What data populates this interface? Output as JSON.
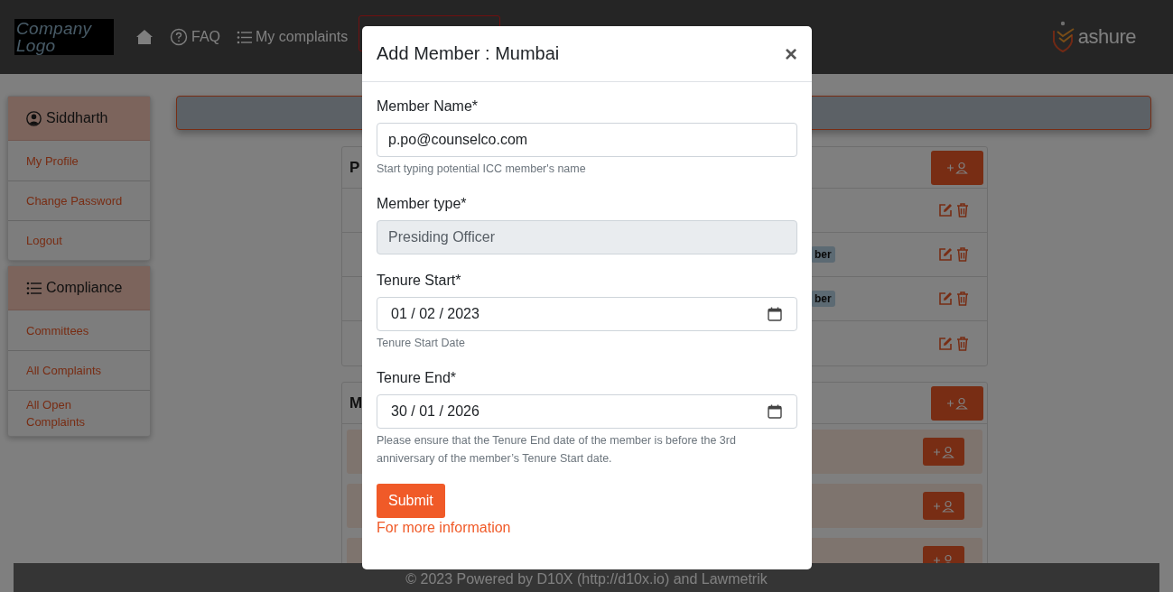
{
  "header": {
    "logo_text": "Company Logo",
    "nav": [
      {
        "kind": "home"
      },
      {
        "kind": "faq",
        "label": "FAQ"
      },
      {
        "kind": "list",
        "label": "My complaints"
      }
    ],
    "brand": "ashure"
  },
  "sidebar": [
    {
      "kind": "user",
      "title": "Siddharth",
      "items": [
        "My Profile",
        "Change Password",
        "Logout"
      ]
    },
    {
      "kind": "list",
      "title": "Compliance",
      "items": [
        "Committees",
        "All Complaints",
        "All Open Complaints"
      ]
    }
  ],
  "cards": [
    {
      "heading": "P",
      "rows": [
        {
          "kind": "member"
        },
        {
          "kind": "member",
          "badge": "ber"
        },
        {
          "kind": "member",
          "badge": "ber"
        },
        {
          "kind": "member"
        }
      ]
    },
    {
      "heading": "M",
      "rows": [
        {
          "kind": "group"
        },
        {
          "kind": "group"
        },
        {
          "kind": "group"
        }
      ]
    }
  ],
  "footer": "© 2023 Powered by D10X (http://d10x.io) and Lawmetrik",
  "modal": {
    "title": "Add Member : Mumbai",
    "close": "×",
    "fields": [
      {
        "kind": "text",
        "label": "Member Name*",
        "value": "p.po@counselco.com",
        "help": "Start typing potential ICC member's name",
        "disabled": false
      },
      {
        "kind": "select",
        "label": "Member type*",
        "value": "Presiding Officer",
        "disabled": true
      },
      {
        "kind": "date",
        "label": "Tenure Start*",
        "value": "01 / 02 / 2023",
        "help": "Tenure Start Date",
        "disabled": false
      },
      {
        "kind": "date",
        "label": "Tenure End*",
        "value": "30 / 01 / 2026",
        "help": "Please ensure that the Tenure End date of the member is before the 3rd anniversary of the member’s Tenure Start date.",
        "disabled": false
      }
    ],
    "submit": "Submit",
    "link": "For more information"
  }
}
